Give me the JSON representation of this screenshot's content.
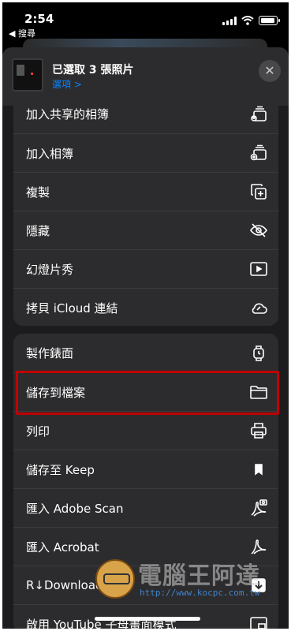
{
  "status": {
    "time": "2:54",
    "back_label": "◀ 搜尋"
  },
  "header": {
    "title": "已選取 3 張照片",
    "options_label": "選項 >",
    "close_glyph": "✕"
  },
  "group1": [
    {
      "label": "加入共享的相簿",
      "icon": "shared-album-icon"
    },
    {
      "label": "加入相簿",
      "icon": "add-album-icon"
    },
    {
      "label": "複製",
      "icon": "duplicate-icon"
    },
    {
      "label": "隱藏",
      "icon": "hide-eye-icon"
    },
    {
      "label": "幻燈片秀",
      "icon": "slideshow-play-icon"
    },
    {
      "label": "拷貝 iCloud 連結",
      "icon": "icloud-link-icon"
    }
  ],
  "group2": [
    {
      "label": "製作錶面",
      "icon": "watch-icon"
    },
    {
      "label": "儲存到檔案",
      "icon": "folder-icon"
    },
    {
      "label": "列印",
      "icon": "printer-icon"
    },
    {
      "label": "儲存至 Keep",
      "icon": "bookmark-icon"
    },
    {
      "label": "匯入 Adobe Scan",
      "icon": "adobe-scan-icon"
    },
    {
      "label": "匯入 Acrobat",
      "icon": "acrobat-icon"
    },
    {
      "label": "R↓Download",
      "icon": "download-icon"
    },
    {
      "label": "啟用 YouTube 子母畫面模式",
      "icon": "pip-icon"
    }
  ],
  "highlight_color": "#c00000",
  "accent_color": "#0a84ff",
  "watermark": {
    "text": "電腦王阿達",
    "url": "http://www.kocpc.com.tw"
  }
}
